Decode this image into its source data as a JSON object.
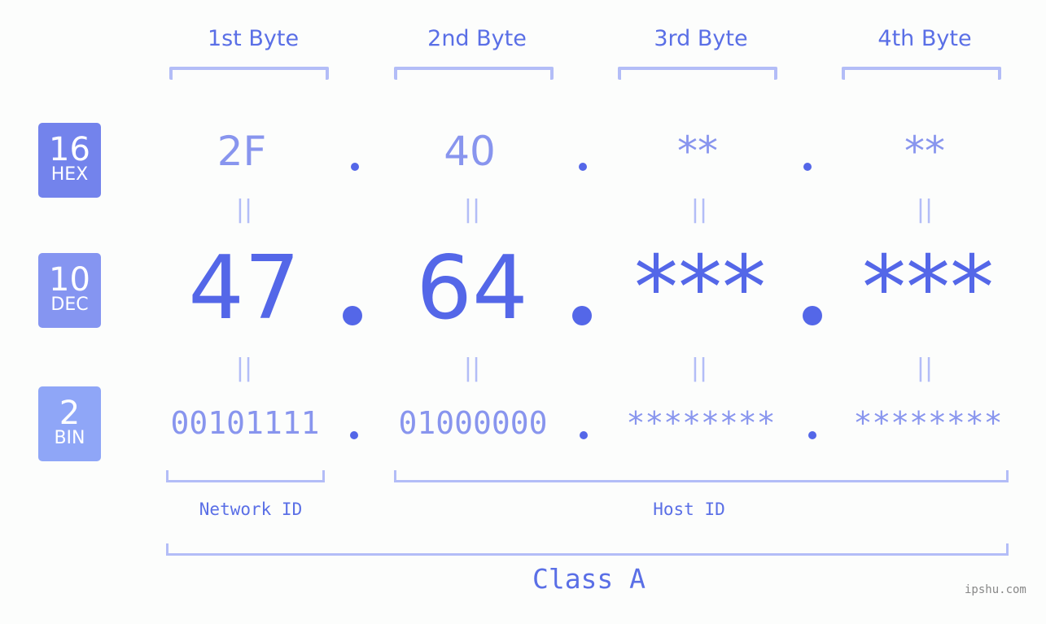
{
  "bytes": [
    {
      "header": "1st Byte",
      "hex": "2F",
      "dec": "47",
      "bin": "00101111"
    },
    {
      "header": "2nd Byte",
      "hex": "40",
      "dec": "64",
      "bin": "01000000"
    },
    {
      "header": "3rd Byte",
      "hex": "**",
      "dec": "***",
      "bin": "********"
    },
    {
      "header": "4th Byte",
      "hex": "**",
      "dec": "***",
      "bin": "********"
    }
  ],
  "badges": {
    "hex": {
      "number": "16",
      "label": "HEX",
      "color": "#7383ec"
    },
    "dec": {
      "number": "10",
      "label": "DEC",
      "color": "#8595f1"
    },
    "bin": {
      "number": "2",
      "label": "BIN",
      "color": "#8fa6f7"
    }
  },
  "equals_sign": "||",
  "network_label": "Network ID",
  "host_label": "Host ID",
  "class_label": "Class A",
  "watermark": "ipshu.com",
  "colors": {
    "accent": "#5467e8",
    "light_accent": "#8895ee",
    "bracket": "#b3bdf7"
  }
}
